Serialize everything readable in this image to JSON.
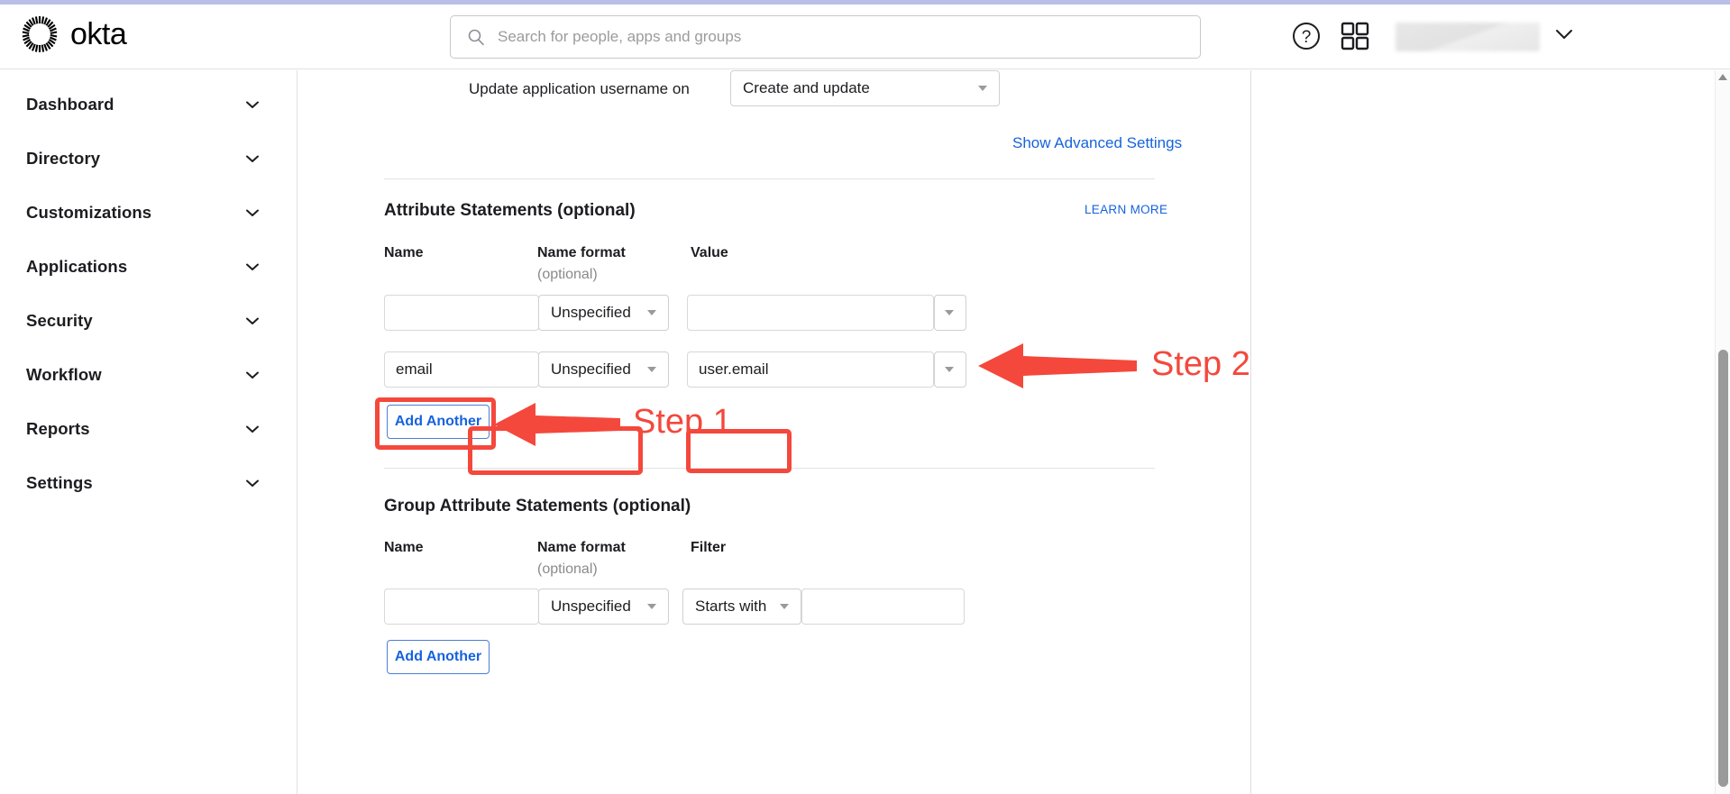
{
  "theme": {
    "accent_blue": "#1662dd",
    "annotation_red": "#f4483c",
    "top_strip": "#b9bfe8",
    "text": "#1d1d21"
  },
  "header": {
    "brand": "okta",
    "logo_icon": "okta-sunburst-icon",
    "search": {
      "icon": "search-icon",
      "placeholder": "Search for people, apps and groups",
      "value": ""
    },
    "help_icon": "question-circle-icon",
    "apps_icon": "apps-grid-icon",
    "user_caret_icon": "chevron-down-icon"
  },
  "sidebar": {
    "items": [
      {
        "label": "Dashboard",
        "icon": "chevron-down-icon"
      },
      {
        "label": "Directory",
        "icon": "chevron-down-icon"
      },
      {
        "label": "Customizations",
        "icon": "chevron-down-icon"
      },
      {
        "label": "Applications",
        "icon": "chevron-down-icon"
      },
      {
        "label": "Security",
        "icon": "chevron-down-icon"
      },
      {
        "label": "Workflow",
        "icon": "chevron-down-icon"
      },
      {
        "label": "Reports",
        "icon": "chevron-down-icon"
      },
      {
        "label": "Settings",
        "icon": "chevron-down-icon"
      }
    ]
  },
  "main": {
    "update_username": {
      "label": "Update application username on",
      "value": "Create and update"
    },
    "show_advanced_link": "Show Advanced Settings",
    "attribute_statements": {
      "title": "Attribute Statements (optional)",
      "learn_more": "LEARN MORE",
      "columns": {
        "name": "Name",
        "name_format": "Name format",
        "name_format_sub": "(optional)",
        "value": "Value"
      },
      "rows": [
        {
          "name": "",
          "name_format": "Unspecified",
          "value": ""
        },
        {
          "name": "email",
          "name_format": "Unspecified",
          "value": "user.email"
        }
      ],
      "add_another": "Add Another"
    },
    "group_attribute_statements": {
      "title": "Group Attribute Statements (optional)",
      "columns": {
        "name": "Name",
        "name_format": "Name format",
        "name_format_sub": "(optional)",
        "filter": "Filter"
      },
      "rows": [
        {
          "name": "",
          "name_format": "Unspecified",
          "filter": "Starts with",
          "filter_value": ""
        }
      ]
    }
  },
  "annotations": [
    {
      "label": "Step 1",
      "target": "add-another-button",
      "arrow": "left-arrow"
    },
    {
      "label": "Step 2",
      "target": "attribute-value-field",
      "arrow": "left-arrow"
    }
  ],
  "scrollbar": {
    "up_arrow_icon": "triangle-up-icon",
    "thumb": "scroll-thumb"
  }
}
